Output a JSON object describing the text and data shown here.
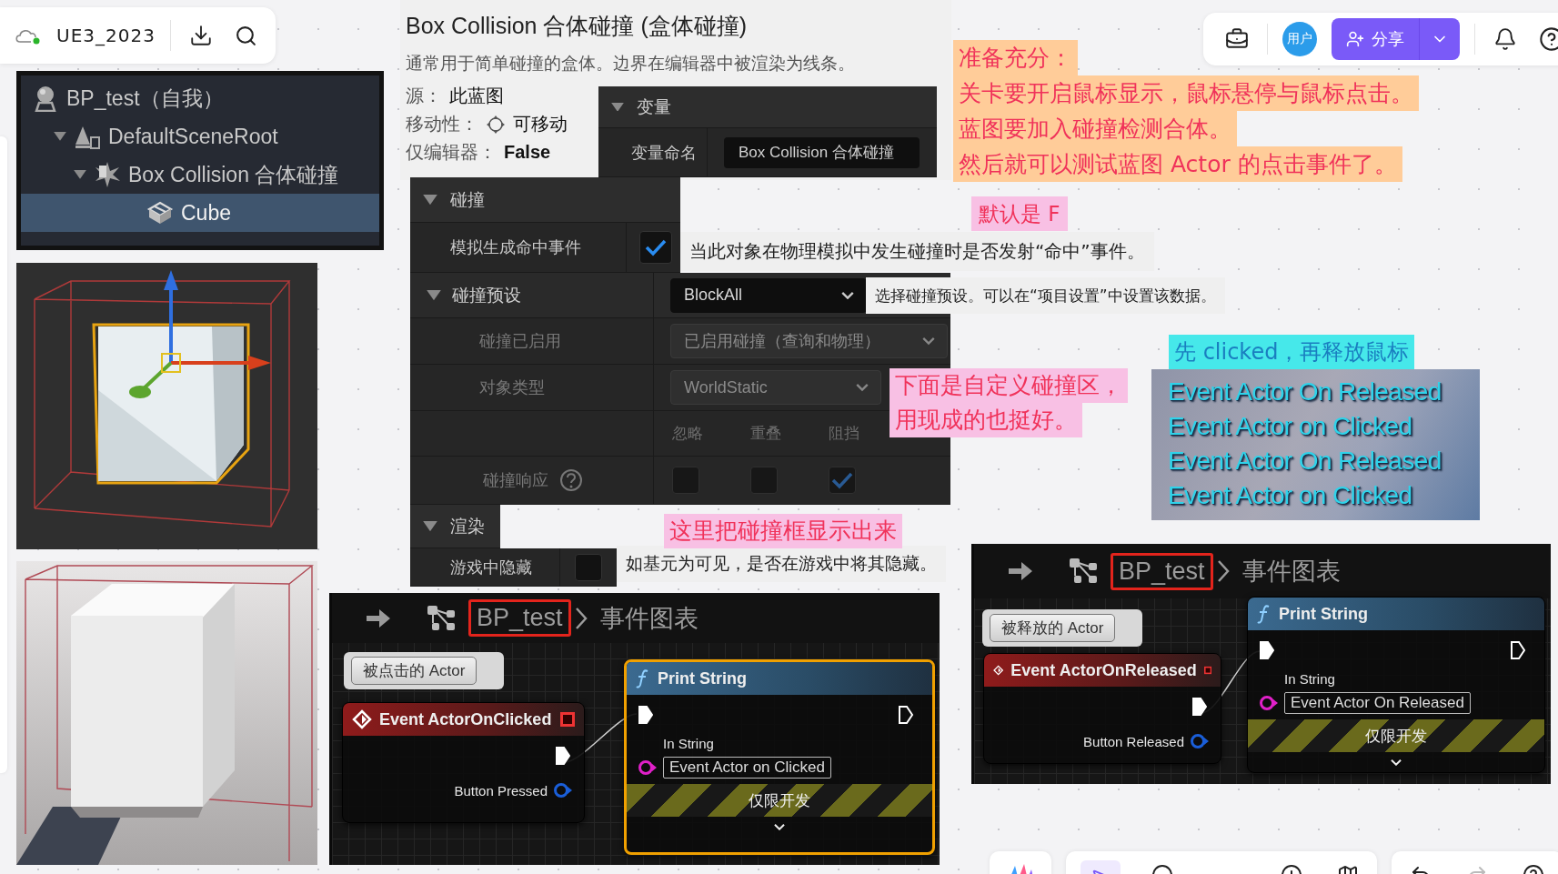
{
  "top_bar": {
    "file_name": "UE3_2023"
  },
  "top_right": {
    "avatar": "用户",
    "share": "分享"
  },
  "outliner": {
    "items": [
      {
        "label": "BP_test（自我）",
        "kind": "actor",
        "selected": false,
        "children": [
          {
            "label": "DefaultSceneRoot",
            "kind": "scene_root",
            "selected": false,
            "children": [
              {
                "label": "Box Collision 合体碰撞",
                "kind": "collision",
                "selected": false,
                "children": [
                  {
                    "label": "Cube",
                    "kind": "mesh",
                    "selected": true
                  }
                ]
              }
            ]
          }
        ]
      }
    ]
  },
  "component_info": {
    "title": "Box Collision 合体碰撞 (盒体碰撞)",
    "description": "通常用于简单碰撞的盒体。边界在编辑器中被渲染为线条。",
    "fields": [
      {
        "label": "源：",
        "value": "此蓝图",
        "kind": "text"
      },
      {
        "label": "移动性：",
        "value": "可移动",
        "kind": "icon_text"
      },
      {
        "label": "仅编辑器：",
        "value": "False",
        "kind": "bold_text"
      }
    ]
  },
  "variables": {
    "section": "变量",
    "label": "变量命名",
    "value": "Box Collision 合体碰撞"
  },
  "collision": {
    "section": "碰撞",
    "simulation_label": "模拟生成命中事件",
    "simulation_checked": true,
    "simulation_tooltip": "当此对象在物理模拟中发生碰撞时是否发射“命中”事件。",
    "preset_section": "碰撞预设",
    "preset_value": "BlockAll",
    "preset_tooltip": "选择碰撞预设。可以在“项目设置”中设置该数据。",
    "rows": [
      {
        "label": "碰撞已启用",
        "value": "已启用碰撞（查询和物理）"
      },
      {
        "label": "对象类型",
        "value": "WorldStatic"
      }
    ],
    "response_columns": [
      "忽略",
      "重叠",
      "阻挡"
    ],
    "response_label": "碰撞响应",
    "responses": [
      {
        "checked": false
      },
      {
        "checked": false
      },
      {
        "checked": true
      }
    ]
  },
  "rendering": {
    "section": "渲染",
    "label": "游戏中隐藏",
    "checked": false,
    "tooltip": "如基元为可见，是否在游戏中将其隐藏。"
  },
  "prep_note": {
    "lines": [
      "准备充分：",
      "关卡要开启鼠标显示，鼠标悬停与鼠标点击。",
      "蓝图要加入碰撞检测合体。",
      "然后就可以测试蓝图 Actor 的点击事件了。"
    ]
  },
  "default_note": "默认是 F",
  "custom_note": {
    "lines": [
      "下面是自定义碰撞区，",
      "用现成的也挺好。"
    ]
  },
  "show_note": "这里把碰撞框显示出来",
  "order_note": "先 clicked，再释放鼠标",
  "event_list": [
    "Event Actor On Released",
    "Event Actor on Clicked",
    "Event Actor On Released",
    "Event Actor on Clicked"
  ],
  "graphs": [
    {
      "breadcrumb": "BP_test",
      "graph_name": "事件图表",
      "comment": "被点击的 Actor",
      "event": "Event ActorOnClicked",
      "pin": "Button Pressed",
      "function": "Print String",
      "in_label": "In String",
      "in_value": "Event Actor on Clicked",
      "dev_label": "仅限开发",
      "selected": true
    },
    {
      "breadcrumb": "BP_test",
      "graph_name": "事件图表",
      "comment": "被释放的 Actor",
      "event": "Event ActorOnReleased",
      "pin": "Button Released",
      "function": "Print String",
      "in_label": "In String",
      "in_value": "Event Actor On Released",
      "dev_label": "仅限开发",
      "selected": false
    }
  ]
}
